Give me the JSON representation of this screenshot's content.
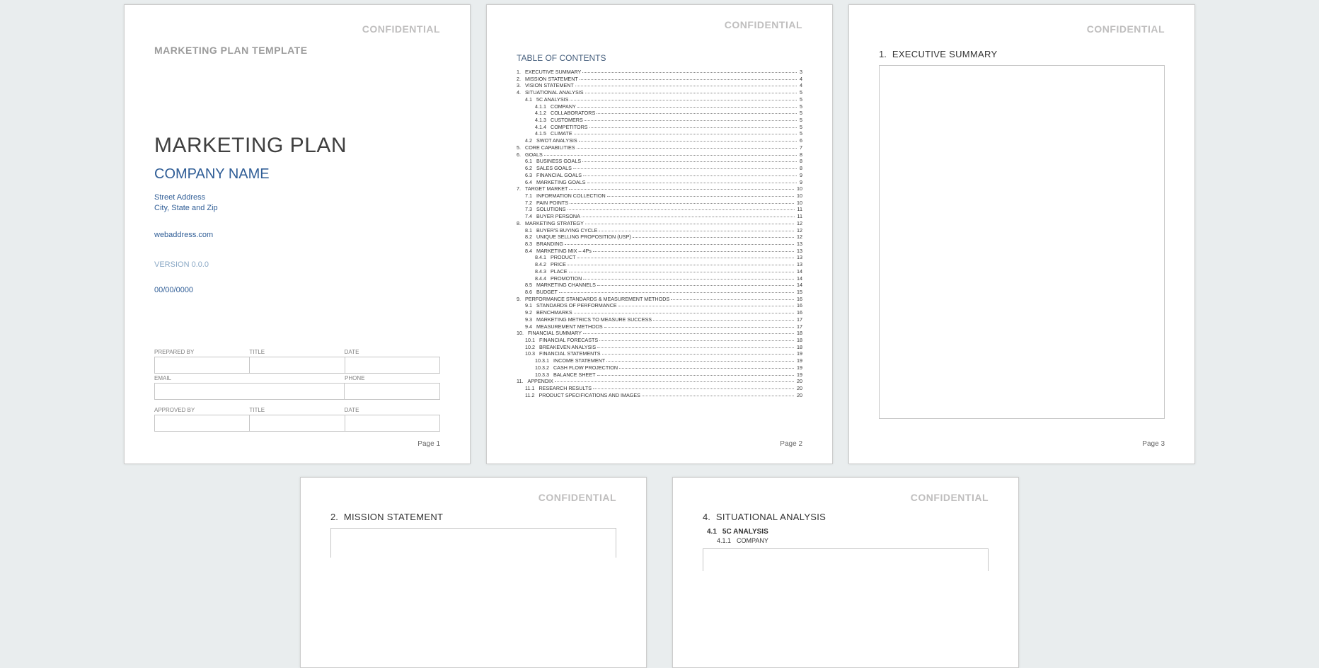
{
  "confidential": "CONFIDENTIAL",
  "page_label_prefix": "Page ",
  "page1": {
    "template_header": "MARKETING PLAN TEMPLATE",
    "title": "MARKETING PLAN",
    "company": "COMPANY NAME",
    "street": "Street Address",
    "city": "City, State and Zip",
    "web": "webaddress.com",
    "version": "VERSION 0.0.0",
    "date": "00/00/0000",
    "labels": {
      "prepared_by": "PREPARED BY",
      "title": "TITLE",
      "date": "DATE",
      "email": "EMAIL",
      "phone": "PHONE",
      "approved_by": "APPROVED BY"
    },
    "pagenum": "1"
  },
  "page2": {
    "toc_title": "TABLE OF CONTENTS",
    "items": [
      {
        "n": "1.",
        "t": "EXECUTIVE SUMMARY",
        "p": "3",
        "ind": 0
      },
      {
        "n": "2.",
        "t": "MISSION STATEMENT",
        "p": "4",
        "ind": 0
      },
      {
        "n": "3.",
        "t": "VISION STATEMENT",
        "p": "4",
        "ind": 0
      },
      {
        "n": "4.",
        "t": "SITUATIONAL ANALYSIS",
        "p": "5",
        "ind": 0
      },
      {
        "n": "4.1",
        "t": "5C ANALYSIS",
        "p": "5",
        "ind": 1
      },
      {
        "n": "4.1.1",
        "t": "COMPANY",
        "p": "5",
        "ind": 2
      },
      {
        "n": "4.1.2",
        "t": "COLLABORATORS",
        "p": "5",
        "ind": 2
      },
      {
        "n": "4.1.3",
        "t": "CUSTOMERS",
        "p": "5",
        "ind": 2
      },
      {
        "n": "4.1.4",
        "t": "COMPETITORS",
        "p": "5",
        "ind": 2
      },
      {
        "n": "4.1.5",
        "t": "CLIMATE",
        "p": "5",
        "ind": 2
      },
      {
        "n": "4.2",
        "t": "SWOT ANALYSIS",
        "p": "6",
        "ind": 1
      },
      {
        "n": "5.",
        "t": "CORE CAPABILITIES",
        "p": "7",
        "ind": 0
      },
      {
        "n": "6.",
        "t": "GOALS",
        "p": "8",
        "ind": 0
      },
      {
        "n": "6.1",
        "t": "BUSINESS GOALS",
        "p": "8",
        "ind": 1
      },
      {
        "n": "6.2",
        "t": "SALES GOALS",
        "p": "8",
        "ind": 1
      },
      {
        "n": "6.3",
        "t": "FINANCIAL GOALS",
        "p": "9",
        "ind": 1
      },
      {
        "n": "6.4",
        "t": "MARKETING GOALS",
        "p": "9",
        "ind": 1
      },
      {
        "n": "7.",
        "t": "TARGET MARKET",
        "p": "10",
        "ind": 0
      },
      {
        "n": "7.1",
        "t": "INFORMATION COLLECTION",
        "p": "10",
        "ind": 1
      },
      {
        "n": "7.2",
        "t": "PAIN POINTS",
        "p": "10",
        "ind": 1
      },
      {
        "n": "7.3",
        "t": "SOLUTIONS",
        "p": "11",
        "ind": 1
      },
      {
        "n": "7.4",
        "t": "BUYER PERSONA",
        "p": "11",
        "ind": 1
      },
      {
        "n": "8.",
        "t": "MARKETING STRATEGY",
        "p": "12",
        "ind": 0
      },
      {
        "n": "8.1",
        "t": "BUYER'S BUYING CYCLE",
        "p": "12",
        "ind": 1
      },
      {
        "n": "8.2",
        "t": "UNIQUE SELLING PROPOSITION (USP)",
        "p": "12",
        "ind": 1
      },
      {
        "n": "8.3",
        "t": "BRANDING",
        "p": "13",
        "ind": 1
      },
      {
        "n": "8.4",
        "t": "MARKETING MIX – 4Ps",
        "p": "13",
        "ind": 1
      },
      {
        "n": "8.4.1",
        "t": "PRODUCT",
        "p": "13",
        "ind": 2
      },
      {
        "n": "8.4.2",
        "t": "PRICE",
        "p": "13",
        "ind": 2
      },
      {
        "n": "8.4.3",
        "t": "PLACE",
        "p": "14",
        "ind": 2
      },
      {
        "n": "8.4.4",
        "t": "PROMOTION",
        "p": "14",
        "ind": 2
      },
      {
        "n": "8.5",
        "t": "MARKETING CHANNELS",
        "p": "14",
        "ind": 1
      },
      {
        "n": "8.6",
        "t": "BUDGET",
        "p": "15",
        "ind": 1
      },
      {
        "n": "9.",
        "t": "PERFORMANCE STANDARDS & MEASUREMENT METHODS",
        "p": "16",
        "ind": 0
      },
      {
        "n": "9.1",
        "t": "STANDARDS OF PERFORMANCE",
        "p": "16",
        "ind": 1
      },
      {
        "n": "9.2",
        "t": "BENCHMARKS",
        "p": "16",
        "ind": 1
      },
      {
        "n": "9.3",
        "t": "MARKETING METRICS TO MEASURE SUCCESS",
        "p": "17",
        "ind": 1
      },
      {
        "n": "9.4",
        "t": "MEASUREMENT METHODS",
        "p": "17",
        "ind": 1
      },
      {
        "n": "10.",
        "t": "FINANCIAL SUMMARY",
        "p": "18",
        "ind": 0
      },
      {
        "n": "10.1",
        "t": "FINANCIAL FORECASTS",
        "p": "18",
        "ind": 1
      },
      {
        "n": "10.2",
        "t": "BREAKEVEN ANALYSIS",
        "p": "18",
        "ind": 1
      },
      {
        "n": "10.3",
        "t": "FINANCIAL STATEMENTS",
        "p": "19",
        "ind": 1
      },
      {
        "n": "10.3.1",
        "t": "INCOME STATEMENT",
        "p": "19",
        "ind": 2
      },
      {
        "n": "10.3.2",
        "t": "CASH FLOW PROJECTION",
        "p": "19",
        "ind": 2
      },
      {
        "n": "10.3.3",
        "t": "BALANCE SHEET",
        "p": "19",
        "ind": 2
      },
      {
        "n": "11.",
        "t": "APPENDIX",
        "p": "20",
        "ind": 0
      },
      {
        "n": "11.1",
        "t": "RESEARCH RESULTS",
        "p": "20",
        "ind": 1
      },
      {
        "n": "11.2",
        "t": "PRODUCT SPECIFICATIONS AND IMAGES",
        "p": "20",
        "ind": 1
      }
    ],
    "pagenum": "2"
  },
  "page3": {
    "heading_num": "1.",
    "heading_txt": "EXECUTIVE SUMMARY",
    "pagenum": "3"
  },
  "page4": {
    "heading_num": "2.",
    "heading_txt": "MISSION STATEMENT"
  },
  "page5": {
    "heading_num": "4.",
    "heading_txt": "SITUATIONAL ANALYSIS",
    "sub1_num": "4.1",
    "sub1_txt": "5C ANALYSIS",
    "sub2_num": "4.1.1",
    "sub2_txt": "COMPANY"
  }
}
